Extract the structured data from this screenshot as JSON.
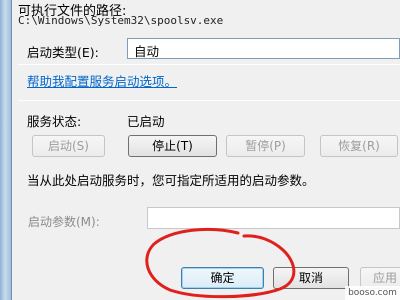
{
  "executable_path": {
    "label": "可执行文件的路径:",
    "value": "C:\\Windows\\System32\\spoolsv.exe"
  },
  "startup_type": {
    "label": "启动类型(E):",
    "selected": "自动"
  },
  "help_link": "帮助我配置服务启动选项。",
  "service_status": {
    "label": "服务状态:",
    "value": "已启动"
  },
  "control_buttons": {
    "start": "启动(S)",
    "stop": "停止(T)",
    "pause": "暂停(P)",
    "resume": "恢复(R)"
  },
  "hint": "当从此处启动服务时，您可指定所适用的启动参数。",
  "start_params": {
    "label": "启动参数(M):",
    "value": ""
  },
  "dialog_buttons": {
    "ok": "确定",
    "cancel": "取消",
    "apply": "应用"
  },
  "watermark": "booso.com",
  "annotation_color": "#e0201c"
}
